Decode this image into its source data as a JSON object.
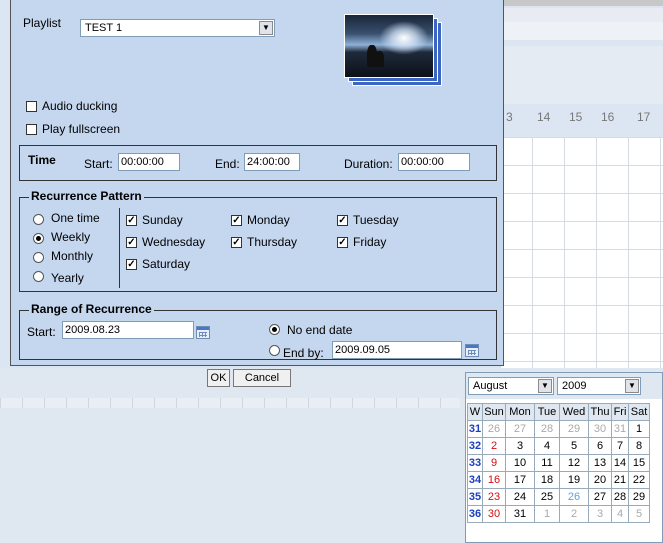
{
  "background": {
    "hours": [
      "3",
      "14",
      "15",
      "16",
      "17"
    ]
  },
  "playlist": {
    "label": "Playlist",
    "value": "TEST 1"
  },
  "options": {
    "audio_ducking": "Audio ducking",
    "play_fullscreen": "Play fullscreen",
    "audio_ducking_checked": false,
    "play_fullscreen_checked": false
  },
  "time": {
    "legend": "Time",
    "start_label": "Start:",
    "start_value": "00:00:00",
    "end_label": "End:",
    "end_value": "24:00:00",
    "duration_label": "Duration:",
    "duration_value": "00:00:00"
  },
  "recurrence": {
    "legend": "Recurrence Pattern",
    "patterns": [
      "One time",
      "Weekly",
      "Monthly",
      "Yearly"
    ],
    "selected_pattern": "Weekly",
    "days": [
      "Sunday",
      "Monday",
      "Tuesday",
      "Wednesday",
      "Thursday",
      "Friday",
      "Saturday"
    ],
    "checked_days": [
      "Sunday",
      "Monday",
      "Tuesday",
      "Wednesday",
      "Thursday",
      "Friday",
      "Saturday"
    ]
  },
  "range": {
    "legend": "Range of Recurrence",
    "start_label": "Start:",
    "start_value": "2009.08.23",
    "no_end_label": "No end date",
    "end_by_label": "End by:",
    "end_by_value": "2009.09.05",
    "selected": "No end date"
  },
  "buttons": {
    "ok": "OK",
    "cancel": "Cancel"
  },
  "calendar": {
    "month": "August",
    "year": "2009",
    "headers": [
      "W",
      "Sun",
      "Mon",
      "Tue",
      "Wed",
      "Thu",
      "Fri",
      "Sat"
    ],
    "weeks": [
      {
        "w": "31",
        "days": [
          "26",
          "27",
          "28",
          "29",
          "30",
          "31",
          "1"
        ],
        "other": [
          0,
          1,
          2,
          3,
          4,
          5
        ]
      },
      {
        "w": "32",
        "days": [
          "2",
          "3",
          "4",
          "5",
          "6",
          "7",
          "8"
        ],
        "other": []
      },
      {
        "w": "33",
        "days": [
          "9",
          "10",
          "11",
          "12",
          "13",
          "14",
          "15"
        ],
        "other": []
      },
      {
        "w": "34",
        "days": [
          "16",
          "17",
          "18",
          "19",
          "20",
          "21",
          "22"
        ],
        "other": []
      },
      {
        "w": "35",
        "days": [
          "23",
          "24",
          "25",
          "26",
          "27",
          "28",
          "29"
        ],
        "other": [],
        "today": 3
      },
      {
        "w": "36",
        "days": [
          "30",
          "31",
          "1",
          "2",
          "3",
          "4",
          "5"
        ],
        "other": [
          2,
          3,
          4,
          5,
          6
        ]
      }
    ]
  }
}
